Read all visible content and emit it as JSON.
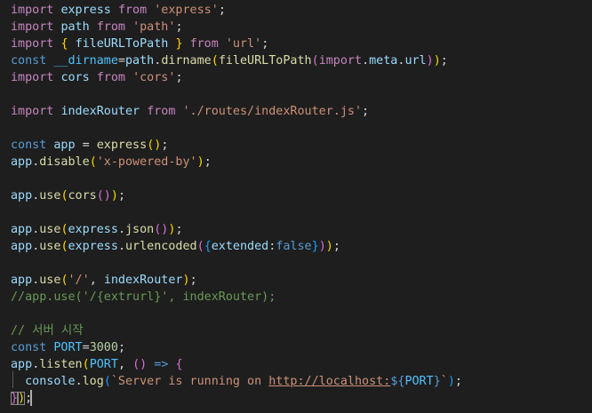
{
  "editor": {
    "lines": [
      [
        [
          "kw",
          "import"
        ],
        [
          "p",
          " "
        ],
        [
          "var",
          "express"
        ],
        [
          "p",
          " "
        ],
        [
          "kw",
          "from"
        ],
        [
          "p",
          " "
        ],
        [
          "str",
          "'express'"
        ],
        [
          "p",
          ";"
        ]
      ],
      [
        [
          "kw",
          "import"
        ],
        [
          "p",
          " "
        ],
        [
          "var",
          "path"
        ],
        [
          "p",
          " "
        ],
        [
          "kw",
          "from"
        ],
        [
          "p",
          " "
        ],
        [
          "str",
          "'path'"
        ],
        [
          "p",
          ";"
        ]
      ],
      [
        [
          "kw",
          "import"
        ],
        [
          "p",
          " "
        ],
        [
          "b1",
          "{"
        ],
        [
          "p",
          " "
        ],
        [
          "var",
          "fileURLToPath"
        ],
        [
          "p",
          " "
        ],
        [
          "b1",
          "}"
        ],
        [
          "p",
          " "
        ],
        [
          "kw",
          "from"
        ],
        [
          "p",
          " "
        ],
        [
          "str",
          "'url'"
        ],
        [
          "p",
          ";"
        ]
      ],
      [
        [
          "decl",
          "const"
        ],
        [
          "p",
          " "
        ],
        [
          "const",
          "__dirname"
        ],
        [
          "p",
          "="
        ],
        [
          "var",
          "path"
        ],
        [
          "p",
          "."
        ],
        [
          "fn",
          "dirname"
        ],
        [
          "b1",
          "("
        ],
        [
          "fn",
          "fileURLToPath"
        ],
        [
          "b2",
          "("
        ],
        [
          "kw",
          "import"
        ],
        [
          "p",
          "."
        ],
        [
          "var",
          "meta"
        ],
        [
          "p",
          "."
        ],
        [
          "var",
          "url"
        ],
        [
          "b2",
          ")"
        ],
        [
          "b1",
          ")"
        ],
        [
          "p",
          ";"
        ]
      ],
      [
        [
          "kw",
          "import"
        ],
        [
          "p",
          " "
        ],
        [
          "var",
          "cors"
        ],
        [
          "p",
          " "
        ],
        [
          "kw",
          "from"
        ],
        [
          "p",
          " "
        ],
        [
          "str",
          "'cors'"
        ],
        [
          "p",
          ";"
        ]
      ],
      [],
      [
        [
          "kw",
          "import"
        ],
        [
          "p",
          " "
        ],
        [
          "var",
          "indexRouter"
        ],
        [
          "p",
          " "
        ],
        [
          "kw",
          "from"
        ],
        [
          "p",
          " "
        ],
        [
          "str",
          "'./routes/indexRouter.js'"
        ],
        [
          "p",
          ";"
        ]
      ],
      [],
      [
        [
          "decl",
          "const"
        ],
        [
          "p",
          " "
        ],
        [
          "var",
          "app"
        ],
        [
          "p",
          " = "
        ],
        [
          "fn",
          "express"
        ],
        [
          "b1",
          "()"
        ],
        [
          "p",
          ";"
        ]
      ],
      [
        [
          "var",
          "app"
        ],
        [
          "p",
          "."
        ],
        [
          "fn",
          "disable"
        ],
        [
          "b1",
          "("
        ],
        [
          "str",
          "'x-powered-by'"
        ],
        [
          "b1",
          ")"
        ],
        [
          "p",
          ";"
        ]
      ],
      [],
      [
        [
          "var",
          "app"
        ],
        [
          "p",
          "."
        ],
        [
          "fn",
          "use"
        ],
        [
          "b1",
          "("
        ],
        [
          "fn",
          "cors"
        ],
        [
          "b2",
          "()"
        ],
        [
          "b1",
          ")"
        ],
        [
          "p",
          ";"
        ]
      ],
      [],
      [
        [
          "var",
          "app"
        ],
        [
          "p",
          "."
        ],
        [
          "fn",
          "use"
        ],
        [
          "b1",
          "("
        ],
        [
          "var",
          "express"
        ],
        [
          "p",
          "."
        ],
        [
          "fn",
          "json"
        ],
        [
          "b2",
          "()"
        ],
        [
          "b1",
          ")"
        ],
        [
          "p",
          ";"
        ]
      ],
      [
        [
          "var",
          "app"
        ],
        [
          "p",
          "."
        ],
        [
          "fn",
          "use"
        ],
        [
          "b1",
          "("
        ],
        [
          "var",
          "express"
        ],
        [
          "p",
          "."
        ],
        [
          "fn",
          "urlencoded"
        ],
        [
          "b2",
          "("
        ],
        [
          "b3",
          "{"
        ],
        [
          "var",
          "extended"
        ],
        [
          "p",
          ":"
        ],
        [
          "decl",
          "false"
        ],
        [
          "b3",
          "}"
        ],
        [
          "b2",
          ")"
        ],
        [
          "b1",
          ")"
        ],
        [
          "p",
          ";"
        ]
      ],
      [],
      [
        [
          "var",
          "app"
        ],
        [
          "p",
          "."
        ],
        [
          "fn",
          "use"
        ],
        [
          "b1",
          "("
        ],
        [
          "str",
          "'/'"
        ],
        [
          "p",
          ", "
        ],
        [
          "var",
          "indexRouter"
        ],
        [
          "b1",
          ")"
        ],
        [
          "p",
          ";"
        ]
      ],
      [
        [
          "cmt",
          "//app.use('/{extrurl}', indexRouter);"
        ]
      ],
      [],
      [
        [
          "cmt",
          "// 서버 시작"
        ]
      ],
      [
        [
          "decl",
          "const"
        ],
        [
          "p",
          " "
        ],
        [
          "const",
          "PORT"
        ],
        [
          "p",
          "="
        ],
        [
          "num",
          "3000"
        ],
        [
          "p",
          ";"
        ]
      ],
      [
        [
          "var",
          "app"
        ],
        [
          "p",
          "."
        ],
        [
          "fn",
          "listen"
        ],
        [
          "b1",
          "("
        ],
        [
          "const",
          "PORT"
        ],
        [
          "p",
          ", "
        ],
        [
          "b2",
          "()"
        ],
        [
          "p",
          " "
        ],
        [
          "decl",
          "=>"
        ],
        [
          "p",
          " "
        ],
        [
          "b2",
          "{"
        ]
      ],
      [
        [
          "p",
          "  "
        ],
        [
          "var",
          "console"
        ],
        [
          "p",
          "."
        ],
        [
          "fn",
          "log"
        ],
        [
          "b3",
          "("
        ],
        [
          "str",
          "`Server is running on "
        ],
        [
          "url",
          "http://localhost:"
        ],
        [
          "decl",
          "${"
        ],
        [
          "const",
          "PORT"
        ],
        [
          "decl",
          "}"
        ],
        [
          "str",
          "`"
        ],
        [
          "b3",
          ")"
        ],
        [
          "p",
          ";"
        ]
      ],
      [
        [
          "b2m",
          "}"
        ],
        [
          "b1m",
          ")"
        ],
        [
          "p",
          ";"
        ]
      ]
    ]
  }
}
